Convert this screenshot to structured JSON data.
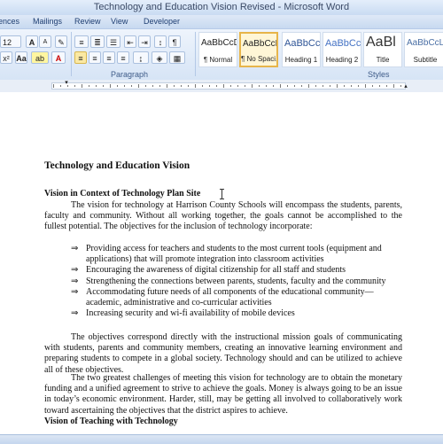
{
  "window": {
    "title": "Technology and Education Vision Revised - Microsoft Word"
  },
  "ribbon_tabs": [
    "ences",
    "Mailings",
    "Review",
    "View",
    "Developer"
  ],
  "font": {
    "size": "12"
  },
  "groups": {
    "paragraph": "Paragraph",
    "styles": "Styles"
  },
  "styles": [
    {
      "preview": "AaBbCcDc",
      "name": "¶ Normal"
    },
    {
      "preview": "AaBbCcDc",
      "name": "¶ No Spaci..."
    },
    {
      "preview": "AaBbCc",
      "name": "Heading 1"
    },
    {
      "preview": "AaBbCc",
      "name": "Heading 2"
    },
    {
      "preview": "AaBl",
      "name": "Title"
    },
    {
      "preview": "AaBbCcL",
      "name": "Subtitle"
    }
  ],
  "document": {
    "title": "Technology and Education Vision",
    "section1_heading": "Vision in Context of Technology Plan Site",
    "para1": "The vision for technology at Harrison County Schools will encompass the students, parents, faculty and community.  Without all working together, the goals cannot be accomplished to the fullest potential.  The objectives for the inclusion of technology incorporate:",
    "bullets": [
      "Providing access for teachers and students to the most current tools (equipment and applications) that will promote integration into classroom activities",
      "Encouraging the awareness of digital citizenship for all staff and students",
      "Strengthening the connections between parents, students, faculty and the community",
      "Accommodating future needs of all components of the educational community—academic, administrative and co-curricular activities",
      "Increasing security and wi-fi availability of mobile devices"
    ],
    "para2": "The objectives correspond directly with the instructional mission goals of communicating with students, parents and community members, creating an innovative learning environment and preparing students to compete in a global society.  Technology should and can be utilized to achieve all of these objectives.",
    "para3": "The two greatest challenges of meeting this vision for technology are to obtain the monetary funding and a unified agreement to strive to achieve the goals.  Money is always going to be an issue in today’s economic environment.  Harder, still, may be getting all involved to collaboratively work toward ascertaining the objectives that the district aspires to achieve.",
    "section2_heading": "Vision of Teaching with Technology"
  },
  "bullet_glyph": "⇒",
  "colors": {
    "ribbon": "#d6e4f6",
    "selected_style": "#e7b54a"
  }
}
